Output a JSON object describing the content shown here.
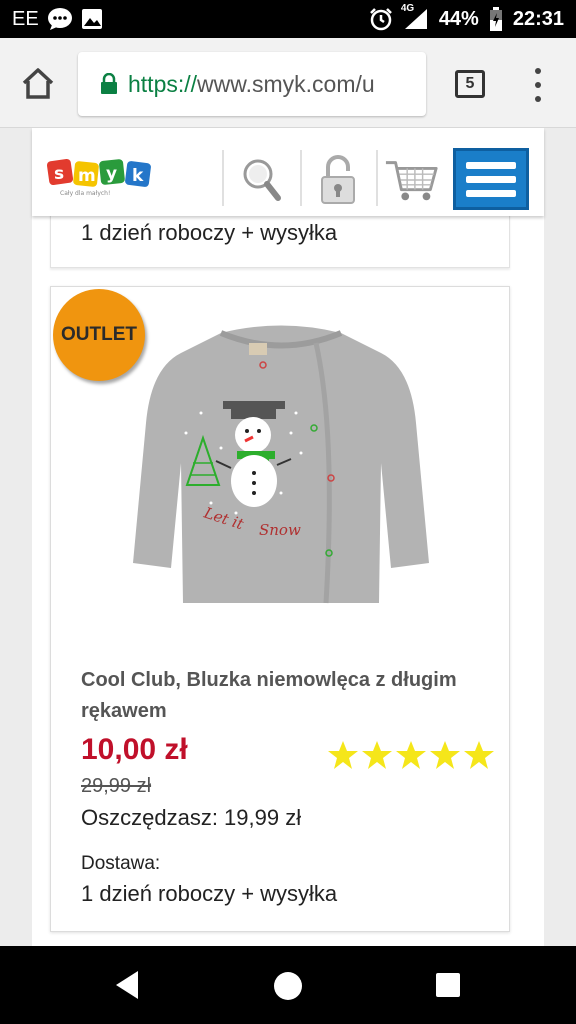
{
  "status_bar": {
    "carrier": "EE",
    "network": "4G",
    "battery": "44%",
    "time": "22:31"
  },
  "browser": {
    "url_scheme": "https://",
    "url_host": "www.smyk.com/u",
    "tab_count": "5"
  },
  "site": {
    "logo_text": "smyk",
    "logo_tagline": "Cały dla małych!",
    "header_icons": [
      "search-icon",
      "lock-icon",
      "cart-icon",
      "menu-icon"
    ],
    "accent_color": "#1a7ec9"
  },
  "previous_card": {
    "delivery_value": "1 dzień roboczy + wysyłka"
  },
  "product": {
    "badge": "OUTLET",
    "title": "Cool Club, Bluzka niemowlęca z długim rękawem",
    "price_now": "10,00 zł",
    "price_old": "29,99 zł",
    "savings": "Oszczędzasz: 19,99 zł",
    "rating_stars": 5,
    "rating_max": 5,
    "delivery_label": "Dostawa:",
    "delivery_value": "1 dzień roboczy + wysyłka",
    "price_color": "#c0102a",
    "badge_color": "#f0950f",
    "star_color": "#f5e61a"
  }
}
